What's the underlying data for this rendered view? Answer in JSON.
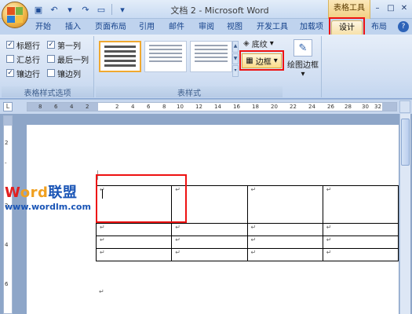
{
  "window": {
    "title": "文档 2 - Microsoft Word",
    "context_tab_group": "表格工具"
  },
  "tabs": [
    "开始",
    "插入",
    "页面布局",
    "引用",
    "邮件",
    "审阅",
    "视图",
    "开发工具",
    "加载项",
    "设计",
    "布局"
  ],
  "active_tab": "设计",
  "ribbon": {
    "options_group": {
      "label": "表格样式选项",
      "items": [
        {
          "label": "标题行",
          "checked": true
        },
        {
          "label": "第一列",
          "checked": true
        },
        {
          "label": "汇总行",
          "checked": false
        },
        {
          "label": "最后一列",
          "checked": false
        },
        {
          "label": "镶边行",
          "checked": true
        },
        {
          "label": "镶边列",
          "checked": false
        }
      ]
    },
    "styles_group": {
      "label": "表样式",
      "shading_label": "底纹",
      "borders_label": "边框"
    },
    "draw_group": {
      "label": "绘图边框"
    }
  },
  "ruler": {
    "marks": [
      "8",
      "6",
      "4",
      "2",
      "2",
      "4",
      "6",
      "8",
      "10",
      "12",
      "14",
      "16",
      "18",
      "20",
      "22",
      "24",
      "26",
      "28",
      "30",
      "32",
      "34"
    ]
  },
  "document": {
    "paragraph_mark": "↵",
    "table": {
      "rows": 4,
      "cols": 4
    }
  },
  "watermark": {
    "brand_w": "W",
    "brand_ord": "ord",
    "brand_cn": "联盟",
    "url": "www.wordlm.com"
  },
  "colors": {
    "highlight": "#e11111",
    "accent": "#f7e1a9"
  },
  "icons": {
    "office": "office-logo-icon",
    "save": "save-icon",
    "undo": "undo-icon",
    "redo": "redo-icon",
    "help": "help-icon",
    "draw": "pencil-icon"
  }
}
